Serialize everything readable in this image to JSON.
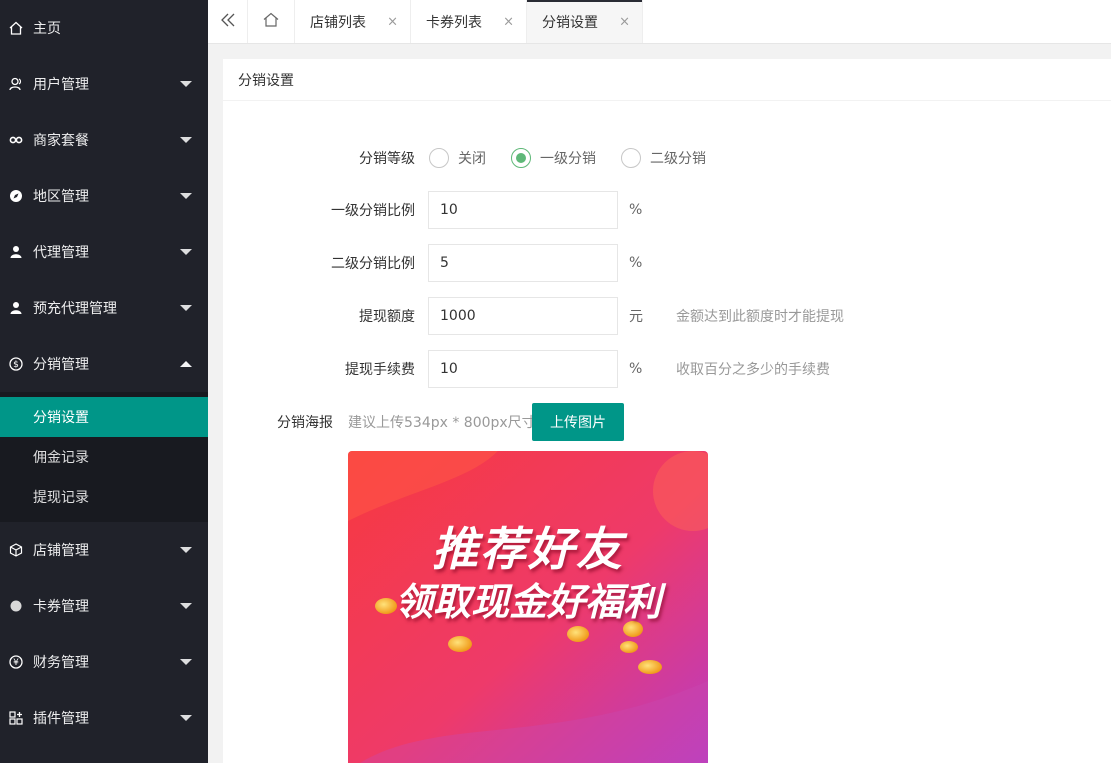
{
  "sidebar": {
    "items": [
      {
        "label": "主页",
        "icon": "home-icon"
      },
      {
        "label": "用户管理",
        "icon": "users-icon"
      },
      {
        "label": "商家套餐",
        "icon": "link-icon"
      },
      {
        "label": "地区管理",
        "icon": "compass-icon"
      },
      {
        "label": "代理管理",
        "icon": "user-icon"
      },
      {
        "label": "预充代理管理",
        "icon": "user-icon"
      },
      {
        "label": "分销管理",
        "icon": "dollar-icon"
      },
      {
        "label": "店铺管理",
        "icon": "cube-icon"
      },
      {
        "label": "卡券管理",
        "icon": "circle-icon"
      },
      {
        "label": "财务管理",
        "icon": "yen-icon"
      },
      {
        "label": "插件管理",
        "icon": "apps-icon"
      }
    ],
    "submenu": [
      {
        "label": "分销设置"
      },
      {
        "label": "佣金记录"
      },
      {
        "label": "提现记录"
      }
    ]
  },
  "tabs": [
    {
      "label": "店铺列表",
      "close": "×"
    },
    {
      "label": "卡券列表",
      "close": "×"
    },
    {
      "label": "分销设置",
      "close": "×"
    }
  ],
  "card": {
    "title": "分销设置"
  },
  "form": {
    "level": {
      "label": "分销等级",
      "options": [
        "关闭",
        "一级分销",
        "二级分销"
      ],
      "selected": "一级分销"
    },
    "first_rate": {
      "label": "一级分销比例",
      "value": "10",
      "unit": "%"
    },
    "second_rate": {
      "label": "二级分销比例",
      "value": "5",
      "unit": "%"
    },
    "withdraw_amount": {
      "label": "提现额度",
      "value": "1000",
      "unit": "元",
      "hint": "金额达到此额度时才能提现"
    },
    "withdraw_fee": {
      "label": "提现手续费",
      "value": "10",
      "unit": "%",
      "hint": "收取百分之多少的手续费"
    },
    "poster": {
      "label": "分销海报",
      "hint": "建议上传534px * 800px尺寸",
      "button": "上传图片",
      "headline": "推荐好友",
      "subline": "领取现金好福利"
    }
  },
  "colors": {
    "sidebar_bg": "#20222a",
    "accent": "#009688",
    "radio_checked": "#5fb878"
  }
}
